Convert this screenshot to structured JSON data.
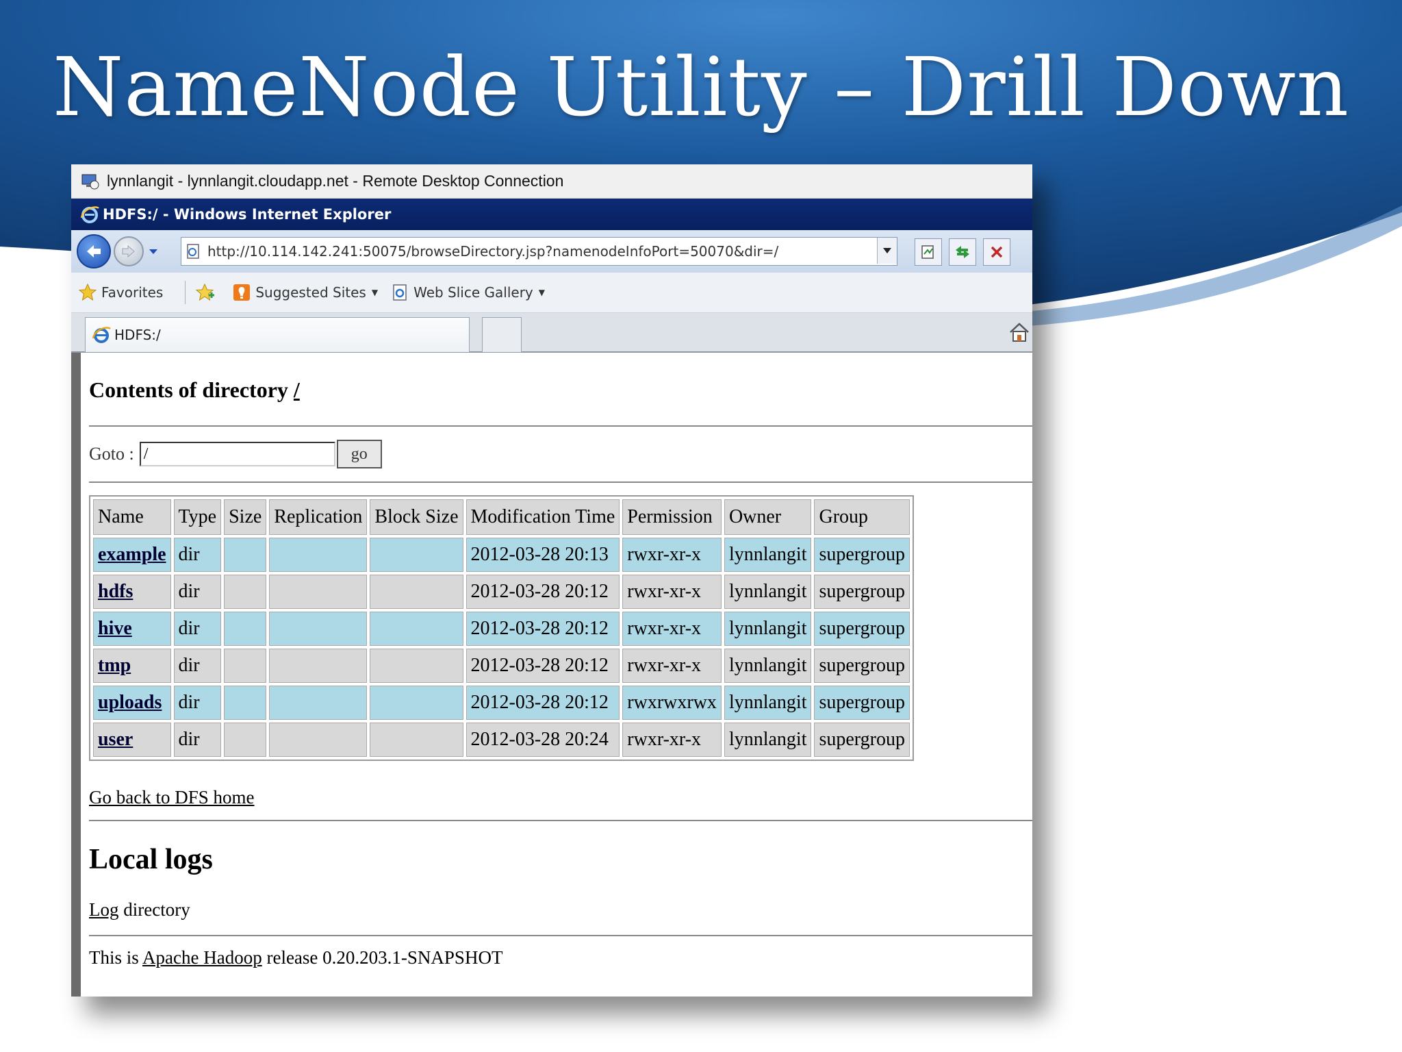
{
  "slide": {
    "title": "NameNode Utility – Drill Down"
  },
  "rdp": {
    "title": "lynnlangit - lynnlangit.cloudapp.net - Remote Desktop Connection"
  },
  "browser": {
    "window_title": "HDFS:/ - Windows Internet Explorer",
    "address": "http://10.114.142.241:50075/browseDirectory.jsp?namenodeInfoPort=50070&dir=/",
    "favorites": {
      "label": "Favorites",
      "suggested_sites": "Suggested Sites",
      "web_slice_gallery": "Web Slice Gallery"
    },
    "tab_label": "HDFS:/"
  },
  "page": {
    "heading_prefix": "Contents of directory",
    "heading_dir": "/",
    "goto_label": "Goto :",
    "goto_value": "/",
    "go_label": "go",
    "columns": [
      "Name",
      "Type",
      "Size",
      "Replication",
      "Block Size",
      "Modification Time",
      "Permission",
      "Owner",
      "Group"
    ],
    "rows": [
      {
        "name": "example",
        "type": "dir",
        "size": "",
        "replication": "",
        "block_size": "",
        "modified": "2012-03-28 20:13",
        "permission": "rwxr-xr-x",
        "owner": "lynnlangit",
        "group": "supergroup"
      },
      {
        "name": "hdfs",
        "type": "dir",
        "size": "",
        "replication": "",
        "block_size": "",
        "modified": "2012-03-28 20:12",
        "permission": "rwxr-xr-x",
        "owner": "lynnlangit",
        "group": "supergroup"
      },
      {
        "name": "hive",
        "type": "dir",
        "size": "",
        "replication": "",
        "block_size": "",
        "modified": "2012-03-28 20:12",
        "permission": "rwxr-xr-x",
        "owner": "lynnlangit",
        "group": "supergroup"
      },
      {
        "name": "tmp",
        "type": "dir",
        "size": "",
        "replication": "",
        "block_size": "",
        "modified": "2012-03-28 20:12",
        "permission": "rwxr-xr-x",
        "owner": "lynnlangit",
        "group": "supergroup"
      },
      {
        "name": "uploads",
        "type": "dir",
        "size": "",
        "replication": "",
        "block_size": "",
        "modified": "2012-03-28 20:12",
        "permission": "rwxrwxrwx",
        "owner": "lynnlangit",
        "group": "supergroup"
      },
      {
        "name": "user",
        "type": "dir",
        "size": "",
        "replication": "",
        "block_size": "",
        "modified": "2012-03-28 20:24",
        "permission": "rwxr-xr-x",
        "owner": "lynnlangit",
        "group": "supergroup"
      }
    ],
    "back_link": "Go back to DFS home",
    "logs_heading": "Local logs",
    "log_dir_link": "Log",
    "log_dir_rest": " directory",
    "release_prefix": "This is ",
    "release_link": "Apache Hadoop",
    "release_suffix": " release 0.20.203.1-SNAPSHOT"
  },
  "colors": {
    "slide_blue": "#1f5fa6",
    "row_blue": "#add8e6",
    "row_grey": "#d8d8d8",
    "ie_title_bar": "#0c2a74"
  }
}
